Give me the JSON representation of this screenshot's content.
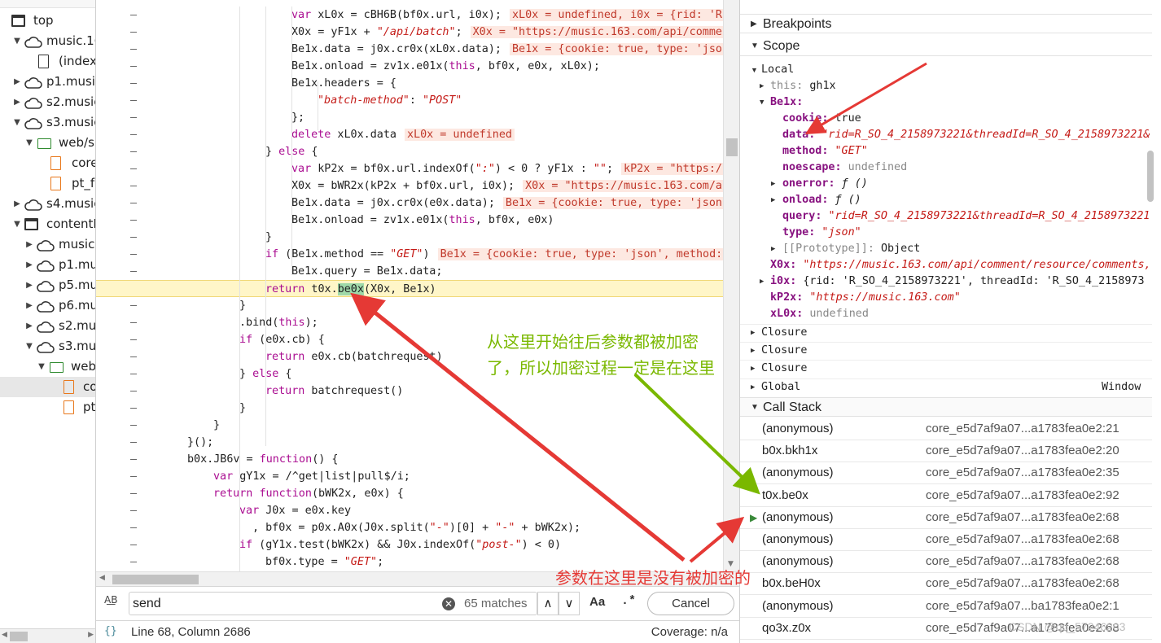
{
  "tree": {
    "items": [
      {
        "label": "top"
      },
      {
        "label": "music.16"
      },
      {
        "label": "(index)"
      },
      {
        "label": "p1.music"
      },
      {
        "label": "s2.music"
      },
      {
        "label": "s3.music"
      },
      {
        "label": "web/s"
      },
      {
        "label": "core"
      },
      {
        "label": "pt_fr"
      },
      {
        "label": "s4.music"
      },
      {
        "label": "contentF"
      },
      {
        "label": "music."
      },
      {
        "label": "p1.mu"
      },
      {
        "label": "p5.mu"
      },
      {
        "label": "p6.mu"
      },
      {
        "label": "s2.mu"
      },
      {
        "label": "s3.mu"
      },
      {
        "label": "web"
      },
      {
        "label": "co"
      },
      {
        "label": "pt"
      }
    ]
  },
  "editor": {
    "lines": [
      {
        "t1": "var xL0x = cBH6B(bf0x.url, i0x);",
        "a": "xL0x = undefined, i0x = {rid: 'R"
      },
      {
        "t1": "X0x = yF1x + \"/api/batch\";",
        "a": "X0x = \"https://music.163.com/api/comme"
      },
      {
        "t1": "Be1x.data = j0x.cr0x(xL0x.data);",
        "a": "Be1x = {cookie: true, type: 'jso"
      },
      {
        "t1": "Be1x.onload = zv1x.e01x(this, bf0x, e0x, xL0x);"
      },
      {
        "t1": "Be1x.headers = {"
      },
      {
        "t1": "\"batch-method\": \"POST\""
      },
      {
        "t1": "};"
      },
      {
        "t1": "delete xL0x.data",
        "a": "xL0x = undefined"
      },
      {
        "t1": "} else {"
      },
      {
        "t1": "var kP2x = bf0x.url.indexOf(\":\") < 0 ? yF1x : \"\";",
        "a": "kP2x = \"https:/"
      },
      {
        "t1": "X0x = bWR2x(kP2x + bf0x.url, i0x);",
        "a": "X0x = \"https://music.163.com/a"
      },
      {
        "t1": "Be1x.data = j0x.cr0x(e0x.data);",
        "a": "Be1x = {cookie: true, type: 'json"
      },
      {
        "t1": "Be1x.onload = zv1x.e01x(this, bf0x, e0x)"
      },
      {
        "t1": "}"
      },
      {
        "t1": "if (Be1x.method == \"GET\")",
        "a": "Be1x = {cookie: true, type: 'json', method:"
      },
      {
        "t1": "Be1x.query = Be1x.data;"
      },
      {
        "t1": "return t0x.be0x(X0x, Be1x)"
      },
      {
        "t1": "}"
      },
      {
        "t1": ".bind(this);"
      },
      {
        "t1": "if (e0x.cb) {"
      },
      {
        "t1": "return e0x.cb(batchrequest)"
      },
      {
        "t1": "} else {"
      },
      {
        "t1": "return batchrequest()"
      },
      {
        "t1": "}"
      },
      {
        "t1": "}"
      },
      {
        "t1": "}();"
      },
      {
        "t1": "b0x.JB6v = function() {"
      },
      {
        "t1": "var gY1x = /^get|list|pull$/i;"
      },
      {
        "t1": "return function(bWK2x, e0x) {"
      },
      {
        "t1": "var J0x = e0x.key"
      },
      {
        "t1": ", bf0x = p0x.A0x(J0x.split(\"-\")[0] + \"-\" + bWK2x);"
      },
      {
        "t1": "if (gY1x.test(bWK2x) && J0x.indexOf(\"post-\") < 0)"
      },
      {
        "t1": "bf0x.type = \"GET\";"
      }
    ],
    "highlighted_line": 16
  },
  "search": {
    "mode_label": "A͟B",
    "value": "send",
    "clear": "✕",
    "count": "65 matches",
    "prev": "∧",
    "next": "∨",
    "case_label": "Aa",
    "regex_label": ".*",
    "cancel_label": "Cancel"
  },
  "status": {
    "format_icon": "{}",
    "cursor": "Line 68, Column 2686",
    "coverage": "Coverage: n/a"
  },
  "debugger": {
    "breakpoints_label": "Breakpoints",
    "scope_label": "Scope",
    "local_label": "Local",
    "this_key": "this",
    "this_val": "gh1x",
    "be1x_key": "Be1x",
    "cookie_key": "cookie",
    "cookie_val": "true",
    "data_key": "data",
    "data_val": "\"rid=R_SO_4_2158973221&threadId=R_SO_4_2158973221&",
    "method_key": "method",
    "method_val": "\"GET\"",
    "noescape_key": "noescape",
    "noescape_val": "undefined",
    "onerror_key": "onerror",
    "onerror_val": "ƒ ()",
    "onload_key": "onload",
    "onload_val": "ƒ ()",
    "query_key": "query",
    "query_val": "\"rid=R_SO_4_2158973221&threadId=R_SO_4_2158973221",
    "type_key": "type",
    "type_val": "\"json\"",
    "proto_key": "[[Prototype]]",
    "proto_val": "Object",
    "x0x_key": "X0x",
    "x0x_val": "\"https://music.163.com/api/comment/resource/comments,",
    "i0x_key": "i0x",
    "i0x_val_a": "{rid: 'R_SO_4_2158973221', threadId: 'R_SO_4_2158973",
    "kp2x_key": "kP2x",
    "kp2x_val": "\"https://music.163.com\"",
    "xl0x_key": "xL0x",
    "xl0x_val": "undefined",
    "closure_1": "Closure",
    "closure_2": "Closure",
    "closure_3": "Closure",
    "global_label": "Global",
    "global_val": "Window",
    "callstack_label": "Call Stack",
    "frames": [
      {
        "name": "(anonymous)",
        "loc": "core_e5d7af9a07...a1783fea0e2:21"
      },
      {
        "name": "b0x.bkh1x",
        "loc": "core_e5d7af9a07...a1783fea0e2:20"
      },
      {
        "name": "(anonymous)",
        "loc": "core_e5d7af9a07...a1783fea0e2:35"
      },
      {
        "name": "t0x.be0x",
        "loc": "core_e5d7af9a07...a1783fea0e2:92"
      },
      {
        "name": "(anonymous)",
        "loc": "core_e5d7af9a07...a1783fea0e2:68"
      },
      {
        "name": "(anonymous)",
        "loc": "core_e5d7af9a07...a1783fea0e2:68"
      },
      {
        "name": "(anonymous)",
        "loc": "core_e5d7af9a07...a1783fea0e2:68"
      },
      {
        "name": "b0x.beH0x",
        "loc": "core_e5d7af9a07...a1783fea0e2:68"
      },
      {
        "name": "(anonymous)",
        "loc": "core_e5d7af9a07...ba1783fea0e2:1"
      },
      {
        "name": "qo3x.z0x",
        "loc": "core_e5d7af9a07...a1783fea0e2:68"
      }
    ],
    "current_frame": 4,
    "watermark": "CSDN @qq_57246203"
  },
  "annotations": {
    "green_line_1": "从这里开始往后参数都被加密",
    "green_line_2": "了，所以加密过程一定是在这里",
    "red_note": "参数在这里是没有被加密的"
  },
  "colors": {
    "highlight_line": "#fff6c8",
    "annotation_red": "#e53935",
    "annotation_green": "#7ab800",
    "keyword": "#aa0d91",
    "string": "#c41a16"
  }
}
